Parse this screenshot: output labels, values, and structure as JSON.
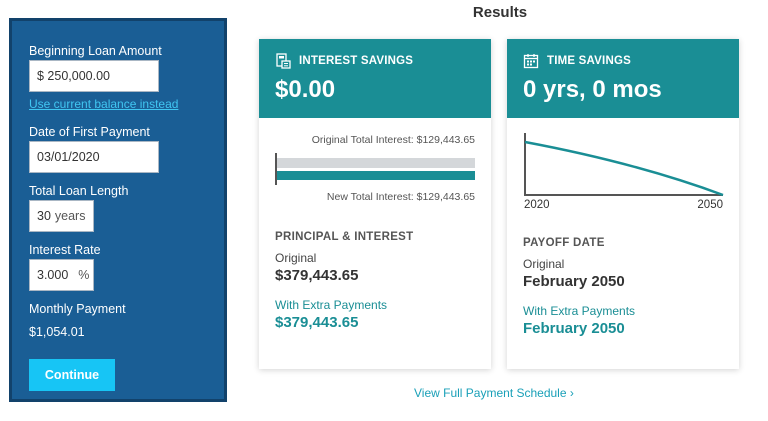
{
  "form": {
    "loan_amount_label": "Beginning Loan Amount",
    "loan_amount_value": "$ 250,000.00",
    "use_balance_link": "Use current balance instead",
    "first_payment_label": "Date of First Payment",
    "first_payment_value": "03/01/2020",
    "loan_length_label": "Total Loan Length",
    "loan_length_value": "30",
    "loan_length_unit": "years",
    "interest_rate_label": "Interest Rate",
    "interest_rate_value": "3.000",
    "interest_rate_unit": "%",
    "monthly_payment_label": "Monthly Payment",
    "monthly_payment_value": "$1,054.01",
    "continue_label": "Continue"
  },
  "results": {
    "title": "Results",
    "interest_card": {
      "title": "INTEREST SAVINGS",
      "icon": "calculator-icon",
      "value": "$0.00",
      "original_interest_text": "Original Total Interest: $129,443.65",
      "new_interest_text": "New Total Interest: $129,443.65",
      "section_title": "PRINCIPAL & INTEREST",
      "original_label": "Original",
      "original_value": "$379,443.65",
      "extra_label": "With Extra Payments",
      "extra_value": "$379,443.65"
    },
    "time_card": {
      "title": "TIME SAVINGS",
      "icon": "calendar-icon",
      "value": "0 yrs, 0 mos",
      "chart_start_label": "2020",
      "chart_end_label": "2050",
      "section_title": "PAYOFF DATE",
      "original_label": "Original",
      "original_value": "February 2050",
      "extra_label": "With Extra Payments",
      "extra_value": "February 2050"
    },
    "schedule_link": "View Full Payment Schedule ›"
  },
  "colors": {
    "panel": "#1a5e95",
    "panel_border": "#12426b",
    "teal": "#1a8e95",
    "button": "#17c5f5",
    "link": "#40c6f2"
  }
}
